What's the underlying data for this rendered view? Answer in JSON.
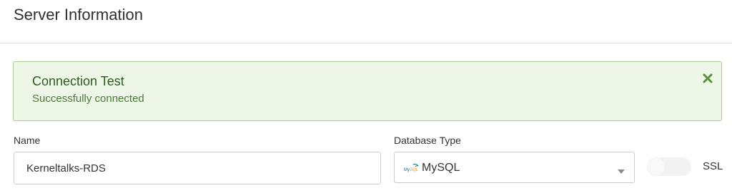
{
  "header": {
    "title": "Server Information"
  },
  "alert": {
    "title": "Connection Test",
    "message": "Successfully connected",
    "close_icon": "close-icon",
    "accent_color": "#5a8f3e"
  },
  "form": {
    "name": {
      "label": "Name",
      "value": "Kerneltalks-RDS"
    },
    "database_type": {
      "label": "Database Type",
      "selected": "MySQL",
      "icon": "mysql-logo-icon"
    },
    "ssl": {
      "label": "SSL",
      "enabled": false
    }
  }
}
